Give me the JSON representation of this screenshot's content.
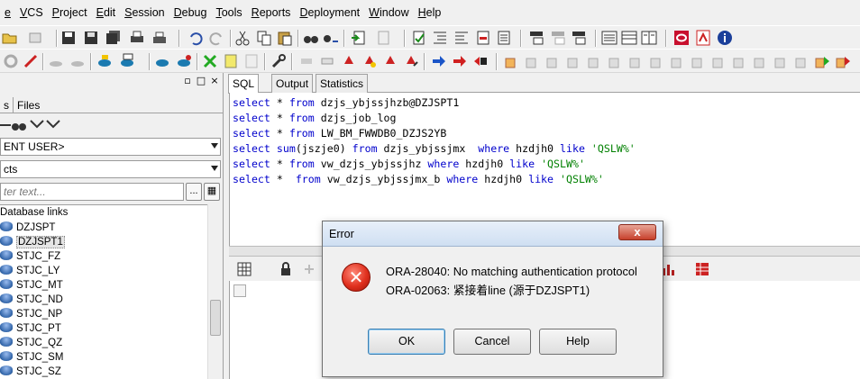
{
  "menu": [
    "e",
    "VCS",
    "Project",
    "Edit",
    "Session",
    "Debug",
    "Tools",
    "Reports",
    "Deployment",
    "Window",
    "Help"
  ],
  "left_panel": {
    "tabs": [
      "s",
      "Files"
    ],
    "user_combo": "ENT USER>",
    "type_combo": "cts",
    "filter_placeholder": "ter text...",
    "filter_btn": "...",
    "tree": {
      "folder": "Database links",
      "items": [
        "DZJSPT",
        "DZJSPT1",
        "STJC_FZ",
        "STJC_LY",
        "STJC_MT",
        "STJC_ND",
        "STJC_NP",
        "STJC_PT",
        "STJC_QZ",
        "STJC_SM",
        "STJC_SZ"
      ],
      "selected": "DZJSPT1"
    }
  },
  "editor": {
    "tabs": [
      "SQL",
      "Output",
      "Statistics"
    ],
    "active_tab": "SQL",
    "lines": [
      [
        {
          "k": "kw",
          "t": "select"
        },
        {
          "k": "",
          "t": " * "
        },
        {
          "k": "kw",
          "t": "from"
        },
        {
          "k": "",
          "t": " dzjs_ybjssjhzb@DZJSPT1"
        }
      ],
      [
        {
          "k": "kw",
          "t": "select"
        },
        {
          "k": "",
          "t": " * "
        },
        {
          "k": "kw",
          "t": "from"
        },
        {
          "k": "",
          "t": " dzjs_job_log"
        }
      ],
      [
        {
          "k": "kw",
          "t": "select"
        },
        {
          "k": "",
          "t": " * "
        },
        {
          "k": "kw",
          "t": "from"
        },
        {
          "k": "",
          "t": " LW_BM_FWWDB0_DZJS2YB"
        }
      ],
      [
        {
          "k": "kw",
          "t": "select"
        },
        {
          "k": "",
          "t": " "
        },
        {
          "k": "kw",
          "t": "sum"
        },
        {
          "k": "",
          "t": "(jszje0) "
        },
        {
          "k": "kw",
          "t": "from"
        },
        {
          "k": "",
          "t": " dzjs_ybjssjmx  "
        },
        {
          "k": "kw",
          "t": "where"
        },
        {
          "k": "",
          "t": " hzdjh0 "
        },
        {
          "k": "kw",
          "t": "like"
        },
        {
          "k": "",
          "t": " "
        },
        {
          "k": "str",
          "t": "'QSLW%'"
        }
      ],
      [
        {
          "k": "kw",
          "t": "select"
        },
        {
          "k": "",
          "t": " * "
        },
        {
          "k": "kw",
          "t": "from"
        },
        {
          "k": "",
          "t": " vw_dzjs_ybjssjhz "
        },
        {
          "k": "kw",
          "t": "where"
        },
        {
          "k": "",
          "t": " hzdjh0 "
        },
        {
          "k": "kw",
          "t": "like"
        },
        {
          "k": "",
          "t": " "
        },
        {
          "k": "str",
          "t": "'QSLW%'"
        }
      ],
      [
        {
          "k": "kw",
          "t": "select"
        },
        {
          "k": "",
          "t": " *  "
        },
        {
          "k": "kw",
          "t": "from"
        },
        {
          "k": "",
          "t": " vw_dzjs_ybjssjmx_b "
        },
        {
          "k": "kw",
          "t": "where"
        },
        {
          "k": "",
          "t": " hzdjh0 "
        },
        {
          "k": "kw",
          "t": "like"
        },
        {
          "k": "",
          "t": " "
        },
        {
          "k": "str",
          "t": "'QSLW%'"
        }
      ]
    ]
  },
  "dialog": {
    "title": "Error",
    "close": "x",
    "icon": "error-icon",
    "message_line1": "ORA-28040: No matching authentication protocol",
    "message_line2": "ORA-02063: 紧接着line (源于DZJSPT1)",
    "buttons": {
      "ok": "OK",
      "cancel": "Cancel",
      "help": "Help"
    }
  }
}
